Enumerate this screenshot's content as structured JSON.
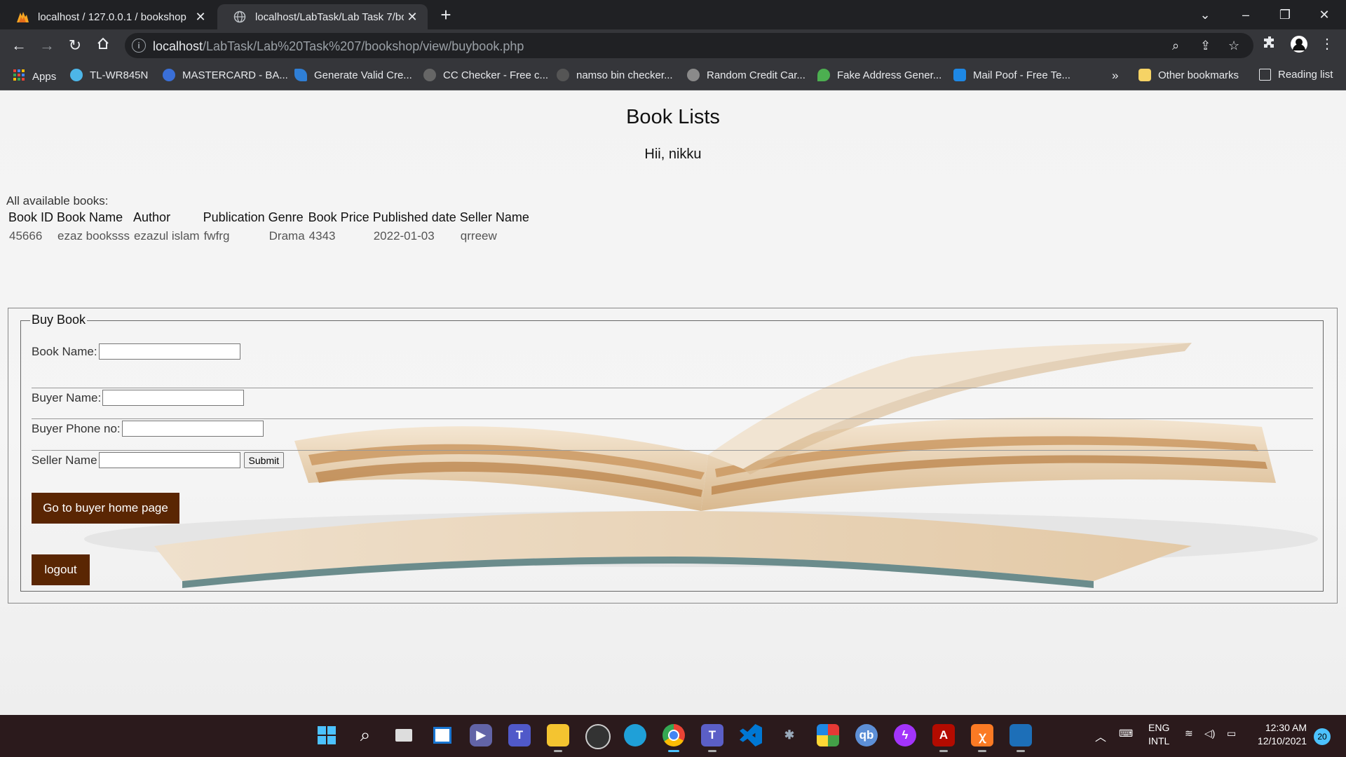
{
  "browser": {
    "tabs": [
      {
        "title": "localhost / 127.0.0.1 / bookshop",
        "icon": "phpmyadmin-icon",
        "active": false
      },
      {
        "title": "localhost/LabTask/Lab Task 7/bo",
        "icon": "globe-icon",
        "active": true
      }
    ],
    "url_host": "localhost",
    "url_path": "/LabTask/Lab%20Task%207/bookshop/view/buybook.php",
    "bookmarks": [
      {
        "label": "Apps",
        "icon": "apps-grid-icon",
        "color": "#e94235"
      },
      {
        "label": "TL-WR845N",
        "icon": "tplink-icon",
        "color": "#4db6e8"
      },
      {
        "label": "MASTERCARD - BA...",
        "icon": "b-icon",
        "color": "#3a6fd8"
      },
      {
        "label": "Generate Valid Cre...",
        "icon": "leaf-icon",
        "color": "#2f7fd6"
      },
      {
        "label": "CC Checker - Free c...",
        "icon": "cc-icon",
        "color": "#666666"
      },
      {
        "label": "namso bin checker...",
        "icon": "person-icon",
        "color": "#555555"
      },
      {
        "label": "Random Credit Car...",
        "icon": "gear-icon",
        "color": "#8a8a8a"
      },
      {
        "label": "Fake Address Gener...",
        "icon": "map-pin-icon",
        "color": "#4caf50"
      },
      {
        "label": "Mail Poof - Free Te...",
        "icon": "mail-icon",
        "color": "#1e88e5"
      }
    ],
    "overflow_label": "»",
    "other_bookmarks": "Other bookmarks",
    "reading_list": "Reading list"
  },
  "page": {
    "heading": "Book Lists",
    "greeting": "Hii, nikku",
    "available_label": "All available books:",
    "table": {
      "headers": [
        "Book ID",
        "Book Name",
        "Author",
        "Publication",
        "Genre",
        "Book Price",
        "Published date",
        "Seller Name"
      ],
      "rows": [
        [
          "45666",
          "ezaz booksss",
          "ezazul islam",
          "fwfrg",
          "Drama",
          "4343",
          "2022-01-03",
          "qrreew"
        ]
      ]
    },
    "form": {
      "legend": "Buy Book",
      "book_name_label": "Book Name:",
      "buyer_name_label": "Buyer Name:",
      "buyer_phone_label": "Buyer Phone no:",
      "seller_name_label": "Seller Name",
      "submit_label": "Submit"
    },
    "buttons": {
      "buyer_home": "Go to buyer home page",
      "logout": "logout"
    },
    "accent_color": "#5a2603"
  },
  "taskbar": {
    "apps": [
      "windows-start-icon",
      "search-icon",
      "task-view-icon",
      "widgets-icon",
      "teams-chat-icon",
      "teams-icon",
      "file-explorer-icon",
      "obs-icon",
      "edge-icon",
      "chrome-icon",
      "teams-work-icon",
      "vscode-icon",
      "bug-icon",
      "colorful-app-icon",
      "qbittorrent-icon",
      "messenger-icon",
      "acrobat-icon",
      "xampp-icon",
      "photos-icon"
    ],
    "lang_line1": "ENG",
    "lang_line2": "INTL",
    "time": "12:30 AM",
    "date": "12/10/2021",
    "notification_count": "20"
  }
}
